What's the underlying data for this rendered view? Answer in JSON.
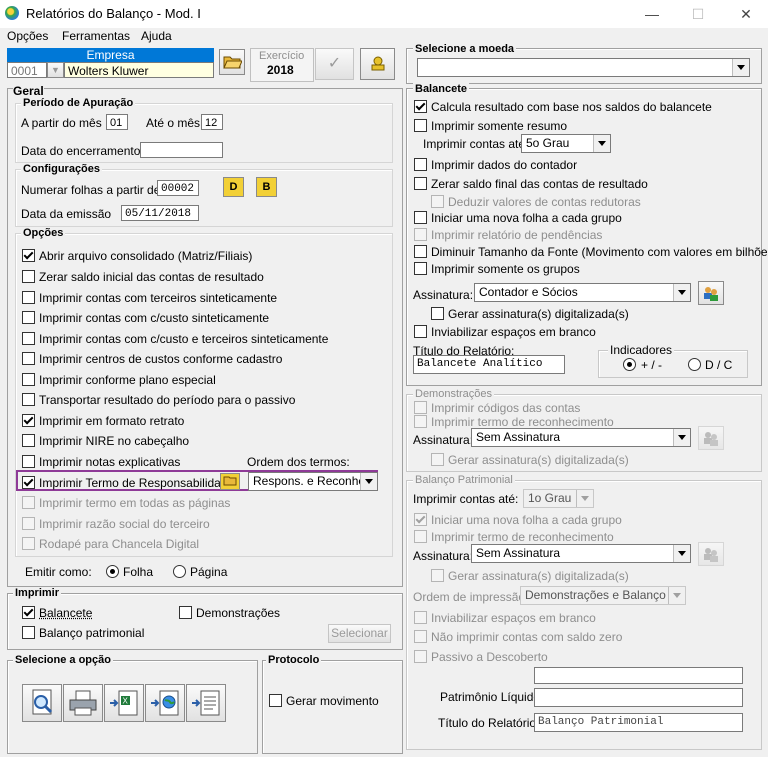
{
  "window": {
    "title": "Relatórios do Balanço - Mod. I"
  },
  "menu": [
    "Opções",
    "Ferramentas",
    "Ajuda"
  ],
  "header": {
    "empresa_label": "Empresa",
    "empresa_code": "0001",
    "empresa_name": "Wolters Kluwer",
    "exercicio_label": "Exercício",
    "exercicio_value": "2018"
  },
  "geral": {
    "title": "Geral",
    "periodo": {
      "title": "Período de Apuração",
      "from_label": "A partir do mês",
      "from_value": "01",
      "to_label": "Até o mês",
      "to_value": "12",
      "closing_label": "Data do encerramento",
      "closing_value": ""
    },
    "config": {
      "title": "Configurações",
      "numerar_label": "Numerar folhas a partir de",
      "numerar_value": "00002",
      "btn_d": "D",
      "btn_b": "B",
      "emissao_label": "Data da emissão",
      "emissao_value": "05/11/2018"
    },
    "opcoes": {
      "title": "Opções",
      "items": [
        "Abrir arquivo consolidado (Matriz/Filiais)",
        "Zerar saldo inicial das contas de resultado",
        "Imprimir contas com terceiros sinteticamente",
        "Imprimir contas com c/custo sinteticamente",
        "Imprimir contas com c/custo e terceiros sinteticamente",
        "Imprimir centros de custos conforme cadastro",
        "Imprimir conforme plano especial",
        "Transportar resultado do período para o passivo",
        "Imprimir em formato retrato",
        "Imprimir NIRE no cabeçalho",
        "Imprimir notas explicativas",
        "Imprimir Termo de Responsabilidade",
        "Imprimir termo em todas as páginas",
        "Imprimir razão social do terceiro",
        "Rodapé para Chancela Digital"
      ],
      "ordem_label": "Ordem dos termos:",
      "ordem_value": "Respons. e Reconhec."
    },
    "emitir_label": "Emitir como:",
    "emitir_folha": "Folha",
    "emitir_pagina": "Página"
  },
  "imprimir": {
    "title": "Imprimir",
    "balancete": "Balancete",
    "demonstracoes": "Demonstrações",
    "balanco": "Balanço patrimonial",
    "selecionar": "Selecionar"
  },
  "selecione_opcao": {
    "title": "Selecione a opção"
  },
  "protocolo": {
    "title": "Protocolo",
    "gerar": "Gerar movimento"
  },
  "moeda": {
    "title": "Selecione a moeda",
    "value": ""
  },
  "balancete": {
    "title": "Balancete",
    "calcula": "Calcula resultado com base nos saldos do balancete",
    "resumo": "Imprimir somente resumo",
    "contas_label": "Imprimir contas até:",
    "contas_value": "5o Grau",
    "dados_contador": "Imprimir dados do contador",
    "zerar_saldo": "Zerar saldo final das contas de resultado",
    "deduzir": "Deduzir valores de contas redutoras",
    "nova_folha": "Iniciar uma nova folha a cada grupo",
    "pendencias": "Imprimir relatório de pendências",
    "diminuir": "Diminuir Tamanho da Fonte (Movimento com valores em bilhões)",
    "somente_grupos": "Imprimir somente os grupos",
    "assinatura_label": "Assinatura:",
    "assinatura_value": "Contador e Sócios",
    "gerar_assinatura": "Gerar assinatura(s) digitalizada(s)",
    "inviabilizar": "Inviabilizar espaços em branco",
    "titulo_label": "Título do Relatório:",
    "titulo_value": "Balancete Analítico",
    "indicadores_title": "Indicadores",
    "ind_pm": "+ / -",
    "ind_dc": "D / C"
  },
  "demonstracoes": {
    "title": "Demonstrações",
    "codigos": "Imprimir códigos das contas",
    "termo": "Imprimir termo de reconhecimento",
    "assinatura_label": "Assinatura:",
    "assinatura_value": "Sem Assinatura",
    "gerar_assinatura": "Gerar assinatura(s) digitalizada(s)"
  },
  "balanco": {
    "title": "Balanço Patrimonial",
    "contas_label": "Imprimir contas até:",
    "contas_value": "1o Grau",
    "nova_folha": "Iniciar uma nova folha a cada grupo",
    "termo": "Imprimir termo de reconhecimento",
    "assinatura_label": "Assinatura:",
    "assinatura_value": "Sem Assinatura",
    "gerar_assinatura": "Gerar assinatura(s) digitalizada(s)",
    "ordem_label": "Ordem de impressão:",
    "ordem_value": "Demonstrações e Balanço",
    "inviabilizar": "Inviabilizar espaços em branco",
    "nao_imprimir": "Não imprimir contas com saldo zero",
    "passivo": "Passivo a Descoberto",
    "campo1_value": "",
    "pl_label": "Patrimônio Líquido",
    "pl_value": "",
    "titulo_label": "Título do Relatório:",
    "titulo_value": "Balanço Patrimonial"
  }
}
